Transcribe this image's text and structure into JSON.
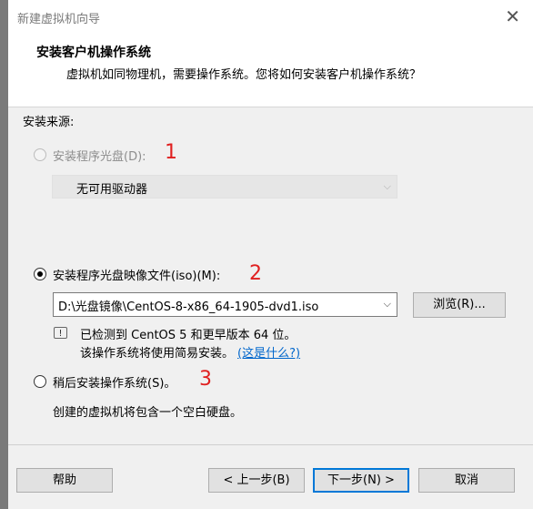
{
  "window": {
    "title": "新建虚拟机向导",
    "close_glyph": "✕"
  },
  "header": {
    "title": "安装客户机操作系统",
    "subtitle": "虚拟机如同物理机，需要操作系统。您将如何安装客户机操作系统？"
  },
  "source_label": "安装来源:",
  "options": {
    "disc": {
      "label": "安装程序光盘(D):",
      "marker": "1",
      "drive_value": "无可用驱动器"
    },
    "iso": {
      "label": "安装程序光盘映像文件(iso)(M):",
      "marker": "2",
      "path_value": "D:\\光盘镜像\\CentOS-8-x86_64-1905-dvd1.iso",
      "browse_label": "浏览(R)..."
    },
    "later": {
      "label": "稍后安装操作系统(S)。",
      "marker": "3",
      "description": "创建的虚拟机将包含一个空白硬盘。"
    }
  },
  "detection": {
    "line1": "已检测到 CentOS 5 和更早版本 64 位。",
    "line2": "该操作系统将使用简易安装。",
    "link": "(这是什么?)"
  },
  "buttons": {
    "help": "帮助",
    "back": "< 上一步(B)",
    "next": "下一步(N) >",
    "cancel": "取消"
  },
  "colors": {
    "marker": "#e02020",
    "link": "#0066cc",
    "default_button_border": "#0078d7"
  }
}
